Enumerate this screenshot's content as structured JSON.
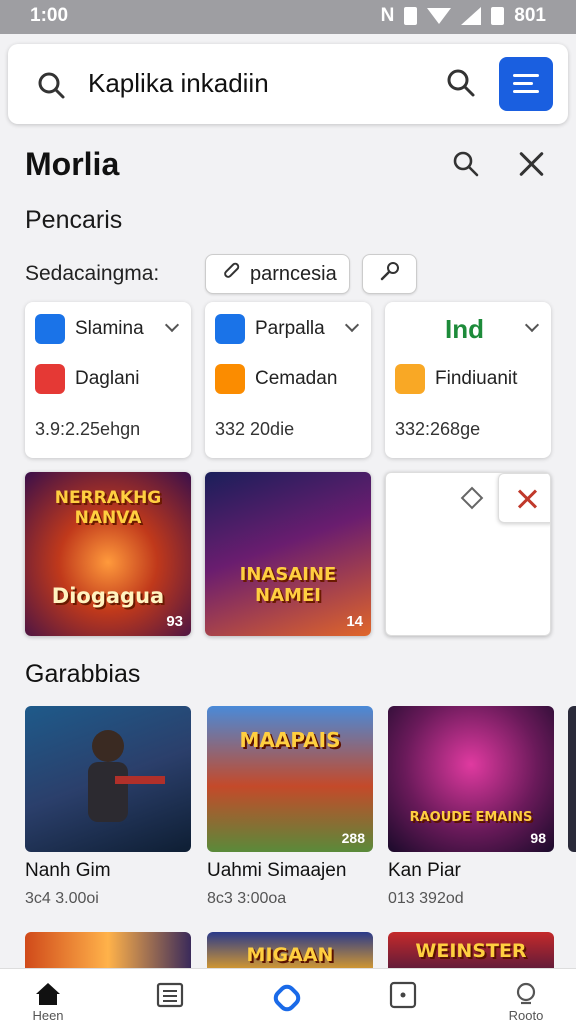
{
  "status_bar": {
    "time": "1:00",
    "indicators": "N",
    "battery": "801"
  },
  "search": {
    "query": "Kaplika inkadiin",
    "leading_icon": "search-icon",
    "menu_icon": "menu-icon"
  },
  "sheet": {
    "title": "Morlia",
    "subtitle": "Pencaris",
    "filter_label": "Sedacaingma:",
    "chip_label": "parncesia"
  },
  "cards": [
    {
      "top_label": "Slamina",
      "top_icon_color": "#1a73e8",
      "second_label": "Daglani",
      "second_icon_color": "#e53935",
      "footer": "3.9:2.25ehgn"
    },
    {
      "top_label": "Parpalla",
      "top_icon_color": "#1a73e8",
      "second_label": "Cemadan",
      "second_icon_color": "#fb8c00",
      "footer": "332 20die"
    },
    {
      "top_label": "Ind",
      "second_label": "Findiuanit",
      "second_icon_color": "#f9a825",
      "footer": "332:268ge"
    }
  ],
  "featured": [
    {
      "title": "NERRAKHG NANVA",
      "subtitle": "Diogagua",
      "badge": "93"
    },
    {
      "title": "INASAINE NAMEI",
      "badge": "14"
    }
  ],
  "section": {
    "title": "Garabbias"
  },
  "games": [
    {
      "name": "Nanh Gim",
      "meta": "3c4 3.00oi",
      "badge": ""
    },
    {
      "name": "Uahmi Simaajen",
      "meta": "8c3 3:00oa",
      "badge": "288",
      "thumb_text": "MAAPAIS"
    },
    {
      "name": "Kan Piar",
      "meta": "013 392od",
      "badge": "98",
      "thumb_text": "RAOUDE EMAINS"
    }
  ],
  "row2": [
    {
      "thumb_text": ""
    },
    {
      "thumb_text": "MIGAAN"
    },
    {
      "thumb_text": "WEINSTER"
    }
  ],
  "nav": [
    {
      "label": "Heen",
      "icon": "home-icon"
    },
    {
      "label": "",
      "icon": "list-icon"
    },
    {
      "label": "",
      "icon": "diamond-icon"
    },
    {
      "label": "",
      "icon": "square-icon"
    },
    {
      "label": "Rooto",
      "icon": "search-icon"
    }
  ],
  "colors": {
    "accent": "#1a5fe0",
    "status_bar": "#9e9ea2",
    "background": "#f2f2f4"
  }
}
